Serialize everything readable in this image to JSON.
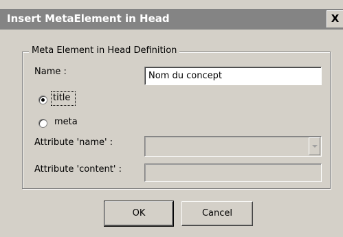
{
  "window": {
    "title": "Insert MetaElement in Head",
    "close_label": "X"
  },
  "group": {
    "legend": "Meta Element in Head Definition"
  },
  "name_field": {
    "label": "Name :",
    "value": "Nom du concept"
  },
  "radios": [
    {
      "label": "title",
      "checked": true
    },
    {
      "label": "meta",
      "checked": false
    }
  ],
  "attr_name": {
    "label": "Attribute 'name' :",
    "value": ""
  },
  "attr_content": {
    "label": "Attribute 'content' :",
    "value": ""
  },
  "buttons": {
    "ok_label": "OK",
    "cancel_label": "Cancel"
  }
}
